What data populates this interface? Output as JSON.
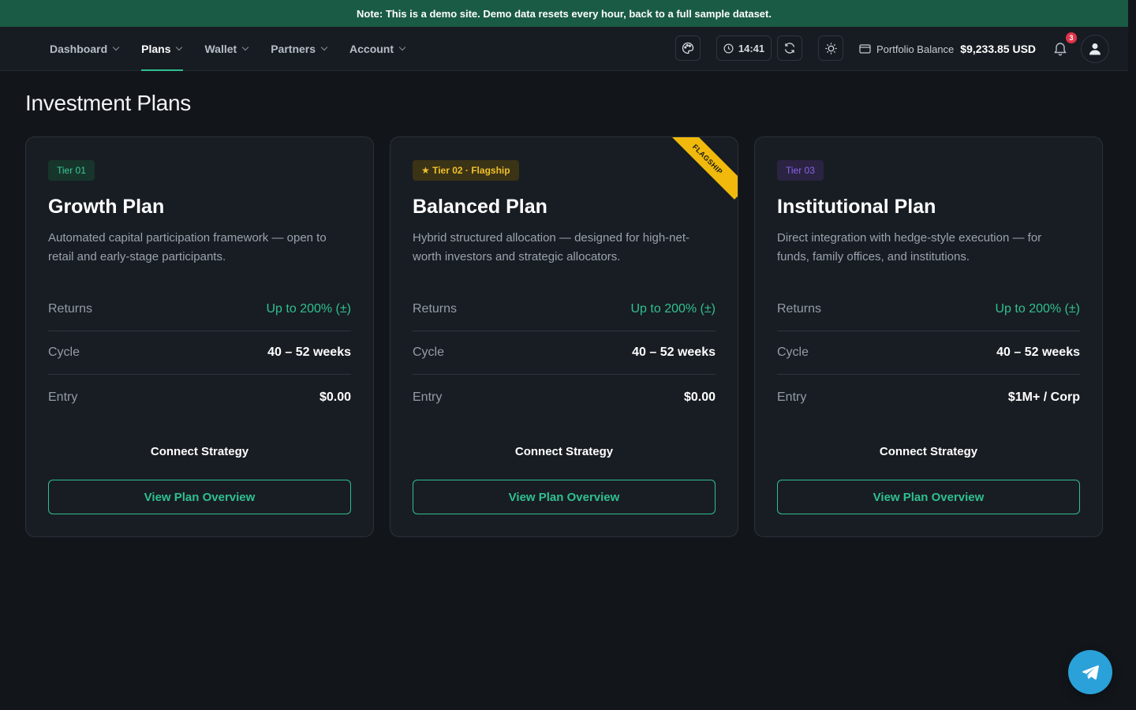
{
  "banner": {
    "text": "Note: This is a demo site. Demo data resets every hour, back to a full sample dataset."
  },
  "nav": {
    "items": [
      {
        "label": "Dashboard"
      },
      {
        "label": "Plans"
      },
      {
        "label": "Wallet"
      },
      {
        "label": "Partners"
      },
      {
        "label": "Account"
      }
    ],
    "active": "Plans"
  },
  "header": {
    "time": "14:41",
    "balance_label": "Portfolio Balance",
    "balance_value": "$9,233.85 USD",
    "notification_count": "3"
  },
  "page": {
    "title": "Investment Plans"
  },
  "plans": [
    {
      "tier": "Tier 01",
      "name": "Growth Plan",
      "description": "Automated capital participation framework — open to retail and early-stage participants.",
      "returns_label": "Returns",
      "returns_value": "Up to 200% (±)",
      "cycle_label": "Cycle",
      "cycle_value": "40 – 52 weeks",
      "entry_label": "Entry",
      "entry_value": "$0.00",
      "connect_label": "Connect Strategy",
      "button_label": "View Plan Overview"
    },
    {
      "tier": "★ Tier 02 · Flagship",
      "ribbon": "FLAGSHIP",
      "name": "Balanced Plan",
      "description": "Hybrid structured allocation — designed for high-net-worth investors and strategic allocators.",
      "returns_label": "Returns",
      "returns_value": "Up to 200% (±)",
      "cycle_label": "Cycle",
      "cycle_value": "40 – 52 weeks",
      "entry_label": "Entry",
      "entry_value": "$0.00",
      "connect_label": "Connect Strategy",
      "button_label": "View Plan Overview"
    },
    {
      "tier": "Tier 03",
      "name": "Institutional Plan",
      "description": "Direct integration with hedge-style execution — for funds, family offices, and institutions.",
      "returns_label": "Returns",
      "returns_value": "Up to 200% (±)",
      "cycle_label": "Cycle",
      "cycle_value": "40 – 52 weeks",
      "entry_label": "Entry",
      "entry_value": "$1M+ / Corp",
      "connect_label": "Connect Strategy",
      "button_label": "View Plan Overview"
    }
  ],
  "colors": {
    "accent": "#2fc08f",
    "banner": "#1a5b45",
    "flagship": "#f0b90b",
    "tier3": "#8a63e6",
    "fab": "#2aa1d8"
  },
  "icons": [
    "palette-icon",
    "clock-icon",
    "refresh-icon",
    "sun-icon",
    "wallet-icon",
    "bell-icon",
    "user-icon",
    "telegram-icon"
  ]
}
